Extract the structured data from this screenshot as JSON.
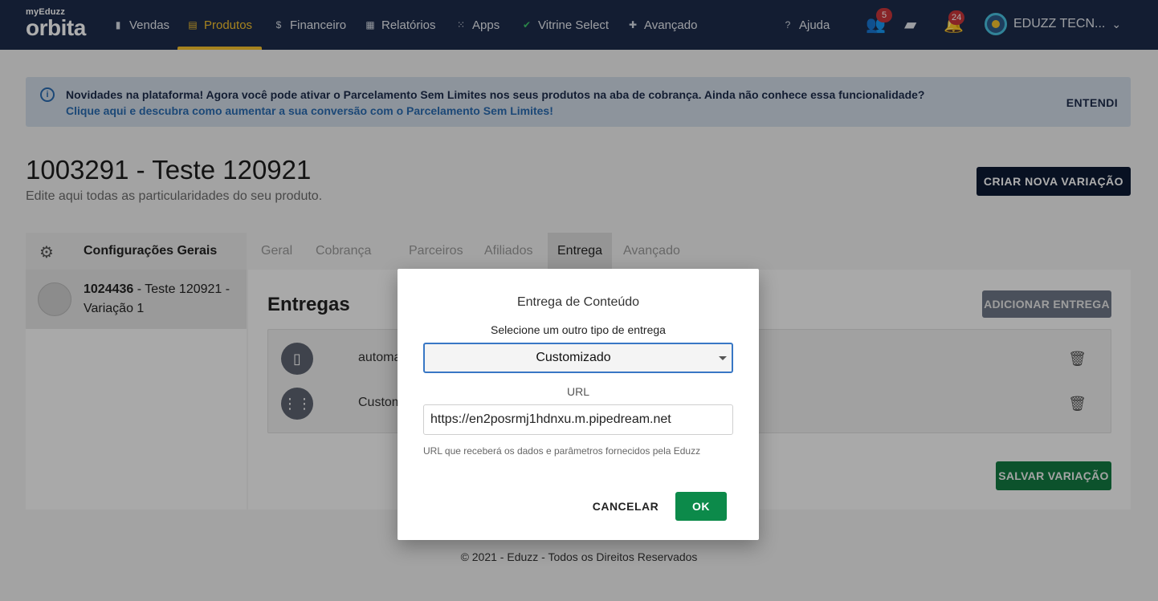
{
  "nav": {
    "logo_small": "myEduzz",
    "logo_big": "orbita",
    "items": [
      {
        "label": "Vendas",
        "icon": "bar-chart-icon"
      },
      {
        "label": "Produtos",
        "icon": "product-icon"
      },
      {
        "label": "Financeiro",
        "icon": "dollar-icon"
      },
      {
        "label": "Relatórios",
        "icon": "report-icon"
      },
      {
        "label": "Apps",
        "icon": "grid-icon"
      },
      {
        "label": "Vitrine Select",
        "icon": "check-badge-icon"
      },
      {
        "label": "Avançado",
        "icon": "puzzle-icon"
      }
    ],
    "active": "Produtos",
    "help_label": "Ajuda",
    "people_badge": "5",
    "notif_badge": "24",
    "user_name": "EDUZZ TECN...",
    "accent_color": "#f5c12e"
  },
  "banner": {
    "text": "Novidades na plataforma! Agora você pode ativar o Parcelamento Sem Limites nos seus produtos na aba de cobrança. Ainda não conhece essa funcionalidade?",
    "link": "Clique aqui e descubra como aumentar a sua conversão com o Parcelamento Sem Limites!",
    "dismiss": "ENTENDI"
  },
  "page": {
    "title": "1003291 - Teste 120921",
    "subtitle": "Edite aqui todas as particularidades do seu produto.",
    "new_variation": "CRIAR NOVA VARIAÇÃO"
  },
  "sidebar": {
    "header": "Configurações Gerais",
    "variation_id": "1024436",
    "variation_name": " - Teste 120921 - Variação 1"
  },
  "tabs": [
    "Geral",
    "Cobrança",
    "Parceiros",
    "Afiliados",
    "Entrega",
    "Avançado"
  ],
  "active_tab": "Entrega",
  "deliveries": {
    "title": "Entregas",
    "add_button": "ADICIONAR ENTREGA",
    "items": [
      {
        "name": "automa",
        "icon": "document-icon"
      },
      {
        "name": "Custom",
        "icon": "custom-delivery-icon"
      }
    ],
    "save_button": "SALVAR VARIAÇÃO"
  },
  "footer": "© 2021 - Eduzz - Todos os Direitos Reservados",
  "modal": {
    "title": "Entrega de Conteúdo",
    "select_label": "Selecione um outro tipo de entrega",
    "select_value": "Customizado",
    "url_label": "URL",
    "url_value": "https://en2posrmj1hdnxu.m.pipedream.net",
    "hint": "URL que receberá os dados e parâmetros fornecidos pela Eduzz",
    "cancel": "CANCELAR",
    "ok": "OK",
    "ok_color": "#0c8a4a"
  }
}
